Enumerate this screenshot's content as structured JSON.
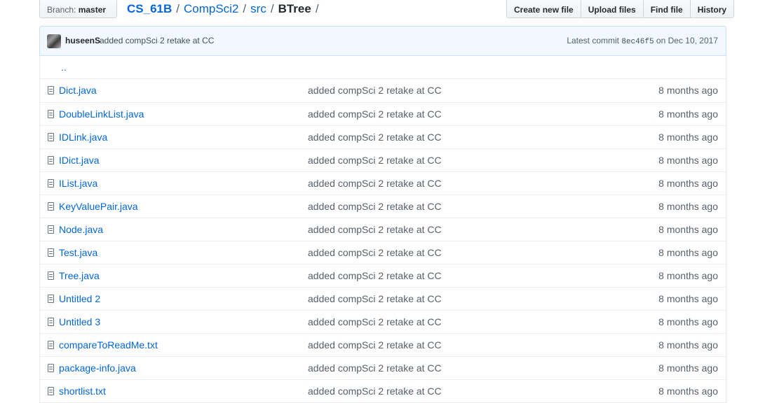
{
  "branch": {
    "prefix": "Branch:",
    "name": "master"
  },
  "breadcrumb": {
    "root": "CS_61B",
    "parts": [
      "CompSci2",
      "src"
    ],
    "current": "BTree",
    "separator": "/"
  },
  "actions": {
    "create": "Create new file",
    "upload": "Upload files",
    "find": "Find file",
    "history": "History"
  },
  "commit": {
    "author": "huseenS",
    "message": "added compSci 2 retake at CC",
    "latest_label": "Latest commit",
    "sha": "8ec46f5",
    "date": "on Dec 10, 2017"
  },
  "parent_dir": "..",
  "files": [
    {
      "name": "Dict.java",
      "message": "added compSci 2 retake at CC",
      "age": "8 months ago"
    },
    {
      "name": "DoubleLinkList.java",
      "message": "added compSci 2 retake at CC",
      "age": "8 months ago"
    },
    {
      "name": "IDLink.java",
      "message": "added compSci 2 retake at CC",
      "age": "8 months ago"
    },
    {
      "name": "IDict.java",
      "message": "added compSci 2 retake at CC",
      "age": "8 months ago"
    },
    {
      "name": "IList.java",
      "message": "added compSci 2 retake at CC",
      "age": "8 months ago"
    },
    {
      "name": "KeyValuePair.java",
      "message": "added compSci 2 retake at CC",
      "age": "8 months ago"
    },
    {
      "name": "Node.java",
      "message": "added compSci 2 retake at CC",
      "age": "8 months ago"
    },
    {
      "name": "Test.java",
      "message": "added compSci 2 retake at CC",
      "age": "8 months ago"
    },
    {
      "name": "Tree.java",
      "message": "added compSci 2 retake at CC",
      "age": "8 months ago"
    },
    {
      "name": "Untitled 2",
      "message": "added compSci 2 retake at CC",
      "age": "8 months ago"
    },
    {
      "name": "Untitled 3",
      "message": "added compSci 2 retake at CC",
      "age": "8 months ago"
    },
    {
      "name": "compareToReadMe.txt",
      "message": "added compSci 2 retake at CC",
      "age": "8 months ago"
    },
    {
      "name": "package-info.java",
      "message": "added compSci 2 retake at CC",
      "age": "8 months ago"
    },
    {
      "name": "shortlist.txt",
      "message": "added compSci 2 retake at CC",
      "age": "8 months ago"
    }
  ],
  "icons": {
    "file": "file-icon",
    "caret": "caret-down-icon"
  },
  "colors": {
    "link": "#0366d6",
    "commit_bg": "#f1f8ff",
    "commit_border": "#c8e1ff",
    "muted": "#586069"
  }
}
